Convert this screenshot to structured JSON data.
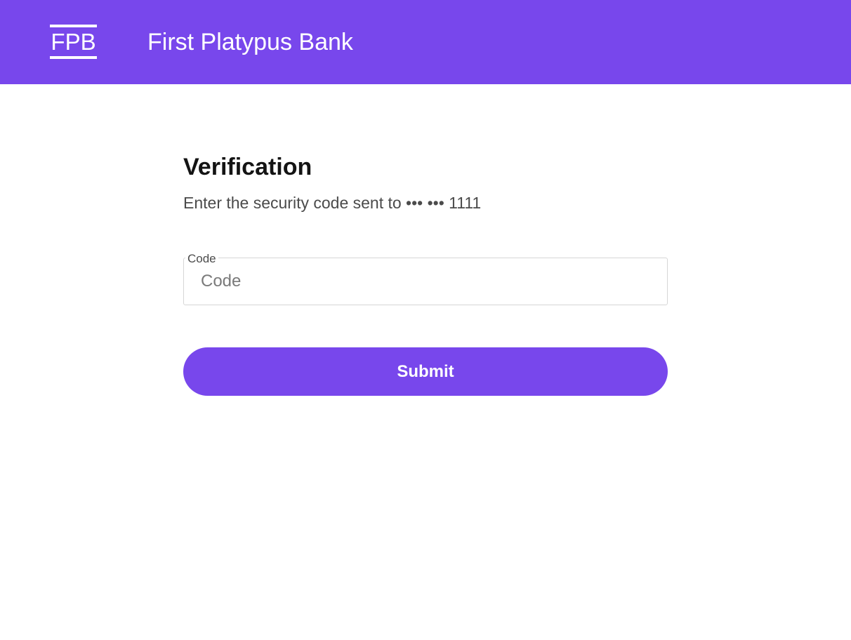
{
  "header": {
    "logo_text": "FPB",
    "bank_name": "First Platypus Bank",
    "background_color": "#7847ec"
  },
  "form": {
    "title": "Verification",
    "subtitle": "Enter the security code sent to ••• ••• 1111",
    "code_field": {
      "label": "Code",
      "placeholder": "Code",
      "value": ""
    },
    "submit_label": "Submit",
    "accent_color": "#7847ec"
  }
}
